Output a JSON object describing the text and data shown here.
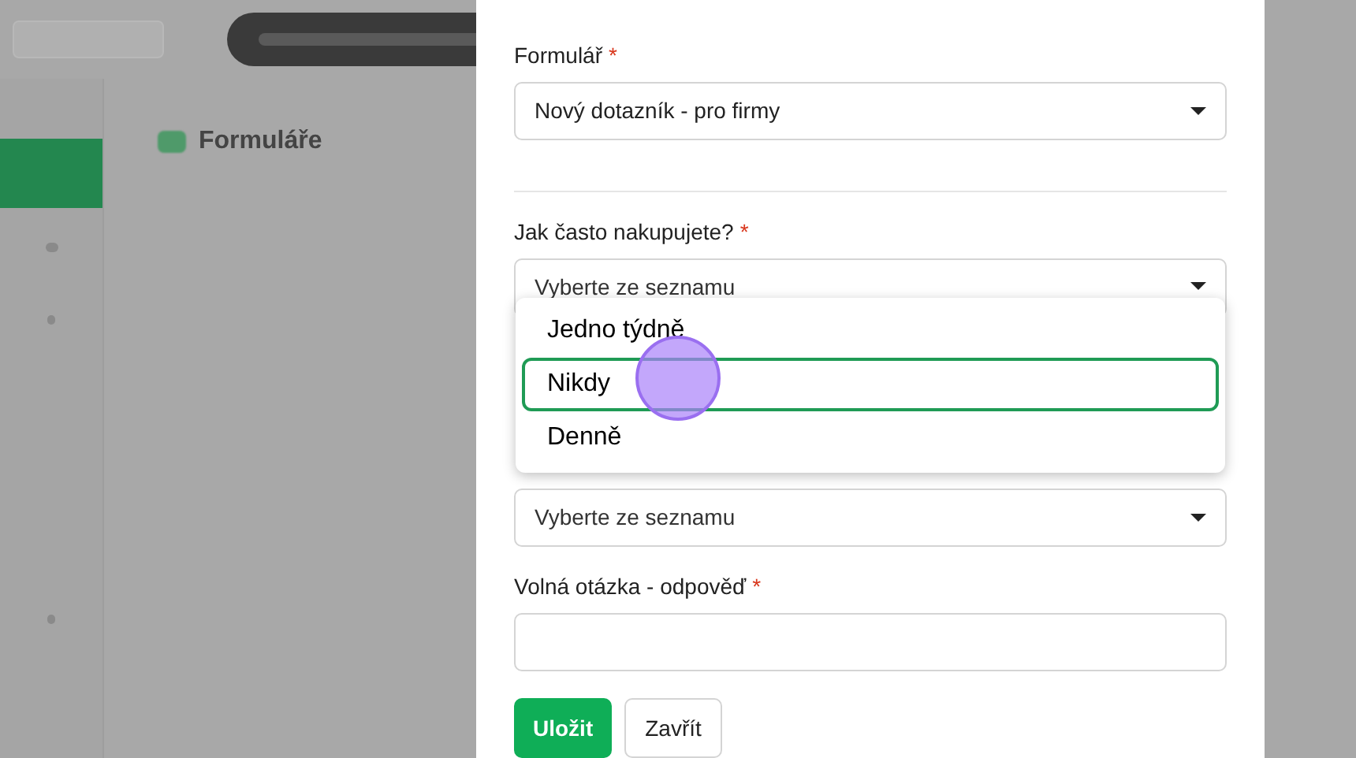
{
  "background": {
    "page_title": "Formuláře"
  },
  "modal": {
    "fields": [
      {
        "kind": "select",
        "label": "Formulář",
        "required_mark": "*",
        "value": "Nový dotazník - pro firmy"
      },
      {
        "kind": "divider"
      },
      {
        "kind": "select",
        "label": "Jak často nakupujete?",
        "required_mark": "*",
        "placeholder": "Vyberte ze seznamu",
        "open": true
      },
      {
        "kind": "hidden"
      },
      {
        "kind": "select",
        "placeholder": "Vyberte ze seznamu"
      },
      {
        "kind": "text",
        "label": "Volná otázka - odpověď",
        "required_mark": "*"
      }
    ],
    "dropdown_options": [
      {
        "label": "Jedno týdně",
        "selected": false
      },
      {
        "label": "Nikdy",
        "selected": true
      },
      {
        "label": "Denně",
        "selected": false
      }
    ],
    "buttons": [
      {
        "label": "Uložit",
        "kind": "primary"
      },
      {
        "label": "Zavřít",
        "kind": "secondary"
      }
    ]
  }
}
